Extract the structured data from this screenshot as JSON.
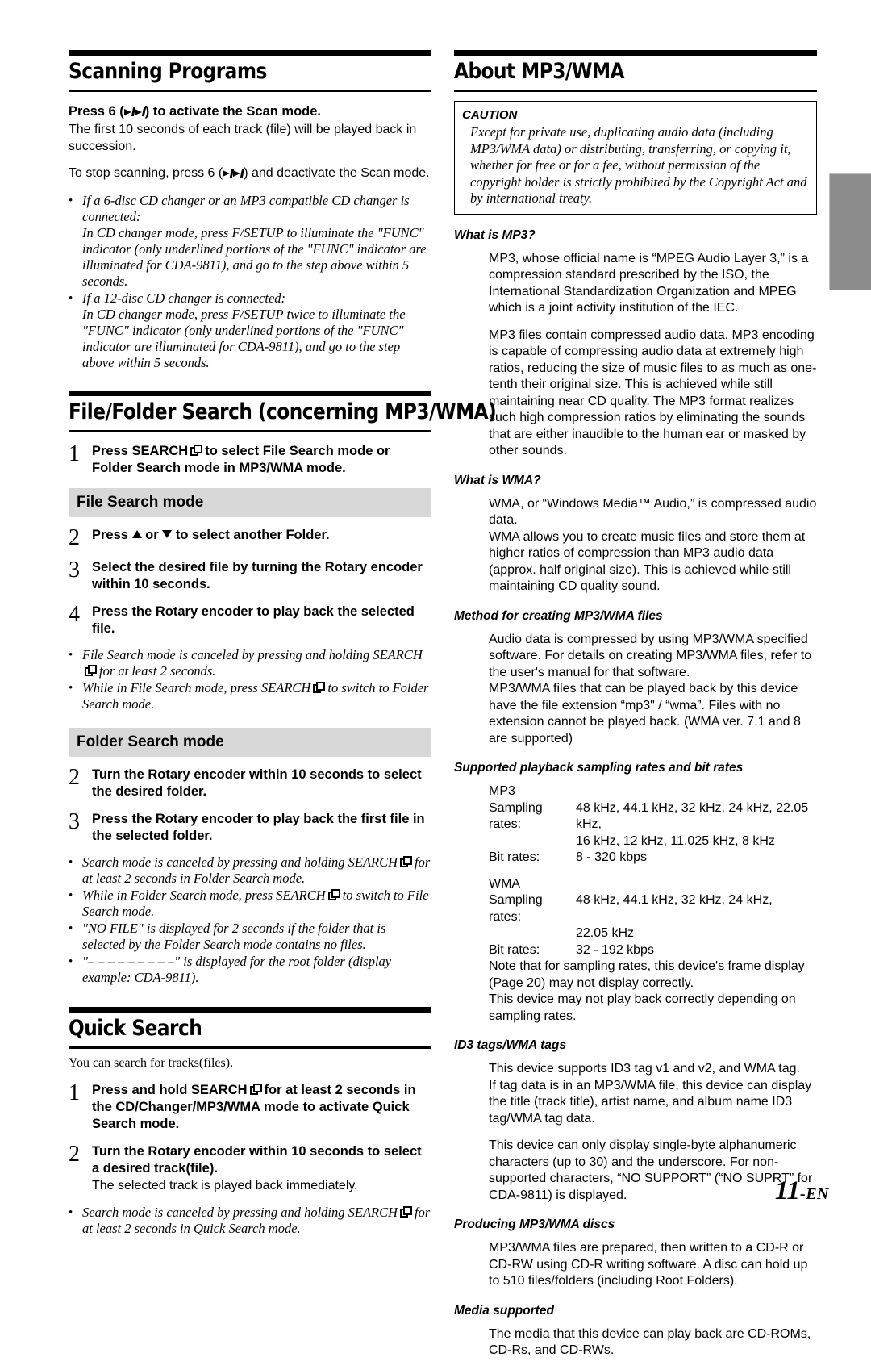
{
  "page": {
    "number": "11",
    "number_suffix": "-EN"
  },
  "left_column": {
    "section1": {
      "title": "Scanning Programs",
      "lead": "Press 6 () to activate the Scan mode.",
      "lead_prefix": "Press 6 (",
      "lead_suffix": ") to activate the Scan mode.",
      "p1": "The first 10 seconds of each track (file) will be played back in succession.",
      "p2_prefix": "To stop scanning, press 6 (",
      "p2_suffix": ") and deactivate the Scan mode.",
      "notes": [
        "If a 6-disc CD changer or an MP3 compatible CD changer is connected:",
        "In CD changer mode, press F/SETUP to illuminate the \"FUNC\" indicator (only underlined portions of the \"FUNC\" indicator are illuminated for CDA-9811), and go to the step above within 5 seconds.",
        "If a 12-disc CD changer is connected:",
        "In CD changer mode, press F/SETUP twice to illuminate the \"FUNC\" indicator (only underlined portions of the \"FUNC\" indicator are illuminated for CDA-9811), and go to the step above within 5 seconds."
      ]
    },
    "section2": {
      "title": "File/Folder Search (concerning MP3/WMA)",
      "step1_num": "1",
      "step1_a": "Press SEARCH",
      "step1_b": "to select File Search mode or Folder Search mode in MP3/WMA mode.",
      "band1": "File Search mode",
      "step2_num": "2",
      "step2_a": "Press",
      "step2_b": "or",
      "step2_c": "to select another Folder.",
      "step3_num": "3",
      "step3_text": "Select the desired file by turning the Rotary encoder within 10 seconds.",
      "step4_num": "4",
      "step4_text": "Press the Rotary encoder to play back the selected file.",
      "notes_a1_pre": "File Search mode is canceled by pressing and holding SEARCH",
      "notes_a1_post": "for at least 2 seconds.",
      "notes_a2_pre": "While in File Search mode, press SEARCH",
      "notes_a2_post": "to switch to Folder Search mode.",
      "band2": "Folder Search mode",
      "step5_num": "2",
      "step5_text": "Turn the Rotary encoder within 10 seconds to select the desired folder.",
      "step6_num": "3",
      "step6_text": "Press the Rotary encoder to play back the first file in the selected folder.",
      "notes_b1_pre": "Search mode is canceled by pressing and holding SEARCH",
      "notes_b1_post": "for at least 2 seconds in Folder Search mode.",
      "notes_b2_pre": "While in Folder Search mode, press SEARCH",
      "notes_b2_post": "to switch to File Search mode.",
      "notes_b3": "\"NO FILE\" is displayed for 2 seconds if the folder that is selected by the Folder Search mode contains no files.",
      "notes_b4": "\"– – – – – – – – –\" is displayed for the root folder (display example: CDA-9811)."
    },
    "section3": {
      "title": "Quick Search",
      "intro": "You can search for tracks(files).",
      "step1_num": "1",
      "step1_a": "Press and hold SEARCH",
      "step1_b": "for at least 2 seconds in the CD/Changer/MP3/WMA mode to activate Quick Search mode.",
      "step2_num": "2",
      "step2_text": "Turn the Rotary encoder within 10 seconds to select a desired track(file).",
      "step2_sub": "The selected track is played back immediately.",
      "note_pre": "Search mode is canceled by pressing and holding SEARCH",
      "note_post": "for at least 2 seconds in Quick Search mode."
    }
  },
  "right_column": {
    "section_title": "About MP3/WMA",
    "caution": {
      "title": "CAUTION",
      "body": "Except for private use, duplicating audio data (including MP3/WMA data) or distributing, transferring, or copying it, whether for free or for a fee, without permission of the copyright holder is strictly prohibited by the Copyright Act and by international treaty."
    },
    "blocks": [
      {
        "heading": "What is MP3?",
        "paragraphs": [
          "MP3, whose official name is “MPEG Audio Layer 3,” is a compression standard prescribed by the ISO, the International Standardization Organization and MPEG which is a joint activity institution of the IEC.",
          "MP3 files contain compressed audio data. MP3 encoding is capable of compressing audio data at extremely high ratios, reducing the size of music files to as much as one-tenth their original size. This is achieved while still maintaining near CD quality. The MP3 format realizes such high compression ratios by eliminating the sounds that are either inaudible to the human ear or masked by other sounds."
        ]
      },
      {
        "heading": "What is WMA?",
        "paragraphs": [
          "WMA, or “Windows Media™ Audio,” is compressed audio data.",
          "WMA allows you to create music files and store them at higher ratios of compression than MP3 audio data (approx. half original size). This is achieved while still maintaining CD quality sound."
        ]
      },
      {
        "heading": "Method for creating MP3/WMA files",
        "paragraphs": [
          "Audio data is compressed by using MP3/WMA specified software. For details on creating MP3/WMA files, refer to the user's manual for that software.",
          "MP3/WMA files that can be played back by this device have the file extension “mp3\" / “wma”. Files with no extension cannot be played back. (WMA ver. 7.1 and 8 are supported)"
        ]
      }
    ],
    "specs": {
      "heading": "Supported playback sampling rates and bit rates",
      "mp3_label": "MP3",
      "mp3_sampling_key": "Sampling rates:",
      "mp3_sampling_v1": "48 kHz, 44.1 kHz, 32 kHz, 24 kHz, 22.05 kHz,",
      "mp3_sampling_v2": "16 kHz, 12 kHz, 11.025 kHz, 8 kHz",
      "mp3_bit_key": "Bit rates:",
      "mp3_bit_v": "8 - 320 kbps",
      "wma_label": "WMA",
      "wma_sampling_key": "Sampling rates:",
      "wma_sampling_v1": "48 kHz, 44.1 kHz, 32 kHz, 24 kHz,",
      "wma_sampling_v2": "22.05 kHz",
      "wma_bit_key": "Bit rates:",
      "wma_bit_v": "32 - 192 kbps",
      "note1": "Note that for sampling rates, this device's frame display (Page 20) may not display correctly.",
      "note2": "This device may not play back correctly depending on sampling rates."
    },
    "blocks2": [
      {
        "heading": "ID3 tags/WMA tags",
        "paragraphs": [
          "This device supports ID3 tag v1 and v2, and WMA tag.\nIf tag data is in an MP3/WMA file, this device can display the title (track title), artist name, and album name ID3 tag/WMA tag data.",
          "This device can only display single-byte alphanumeric characters (up to 30) and the underscore. For non-supported characters, “NO SUPPORT” (“NO SUPRT” for CDA-9811) is displayed."
        ]
      },
      {
        "heading": "Producing MP3/WMA discs",
        "paragraphs": [
          "MP3/WMA files are prepared, then written to a CD-R or CD-RW using CD-R writing software.  A disc can hold up to 510 files/folders (including Root Folders)."
        ]
      },
      {
        "heading": "Media supported",
        "paragraphs": [
          "The media that this device can play back are CD-ROMs, CD-Rs, and CD-RWs."
        ]
      }
    ]
  }
}
